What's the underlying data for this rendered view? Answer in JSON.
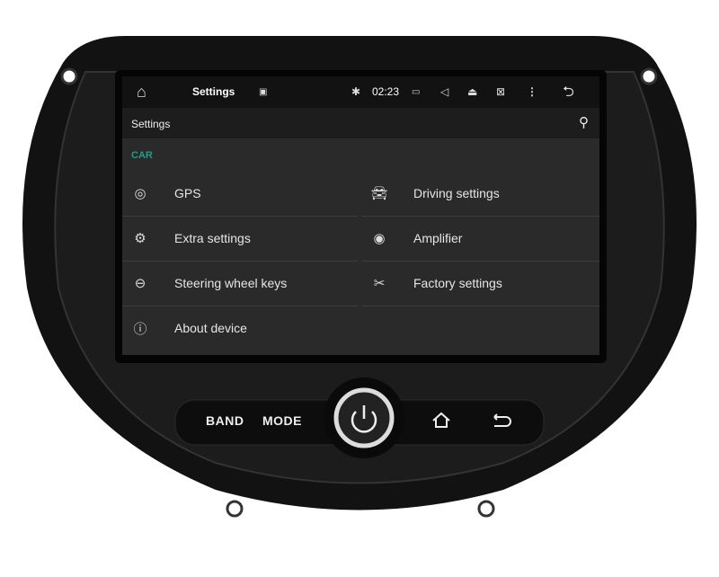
{
  "status_bar": {
    "title": "Settings",
    "time": "02:23"
  },
  "toolbar": {
    "title": "Settings"
  },
  "section": "CAR",
  "items": [
    {
      "label": "GPS",
      "icon": "gps-icon"
    },
    {
      "label": "Driving settings",
      "icon": "car-icon"
    },
    {
      "label": "Extra settings",
      "icon": "gears-icon"
    },
    {
      "label": "Amplifier",
      "icon": "speaker-icon"
    },
    {
      "label": "Steering wheel keys",
      "icon": "steering-wheel-icon"
    },
    {
      "label": "Factory settings",
      "icon": "tools-icon"
    },
    {
      "label": "About device",
      "icon": "info-icon"
    }
  ],
  "hardware": {
    "band": "BAND",
    "mode": "MODE"
  },
  "colors": {
    "accent": "#1f9e8e",
    "screen_bg": "#2a2a2a"
  }
}
